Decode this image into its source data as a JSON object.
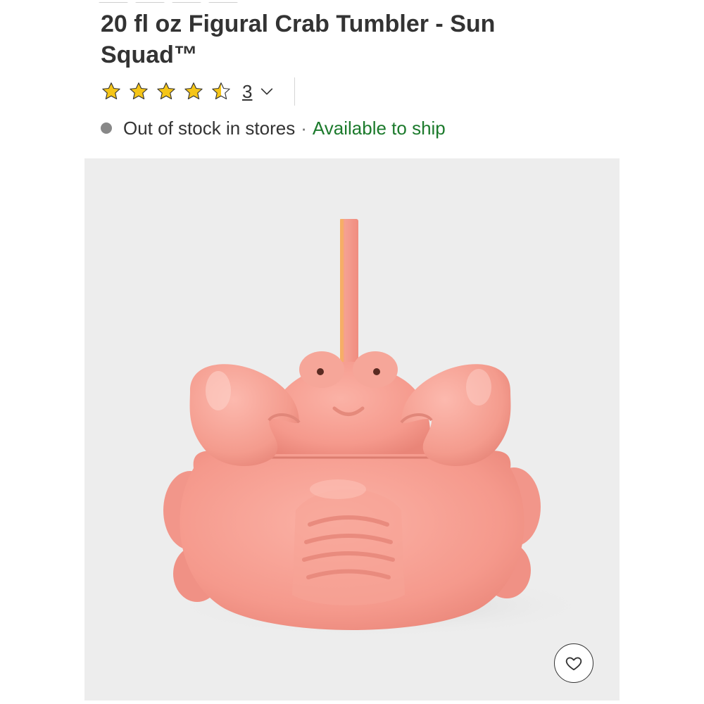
{
  "product": {
    "title": "20 fl oz Figural Crab Tumbler - Sun Squad™"
  },
  "rating": {
    "value": 4.5,
    "max": 5,
    "stars": [
      "star-full",
      "star-full",
      "star-full",
      "star-full",
      "star-half"
    ],
    "review_count": "3",
    "star_color": "#f5c518"
  },
  "availability": {
    "store_status": "Out of stock in stores",
    "separator": "·",
    "ship_status": "Available to ship",
    "ship_color": "#1c7a2c",
    "dot_color": "#888888"
  },
  "image": {
    "background": "#ededed",
    "subject_color": "#f6a095",
    "icon": "crab-tumbler-image"
  },
  "favorite": {
    "icon": "heart-icon"
  }
}
